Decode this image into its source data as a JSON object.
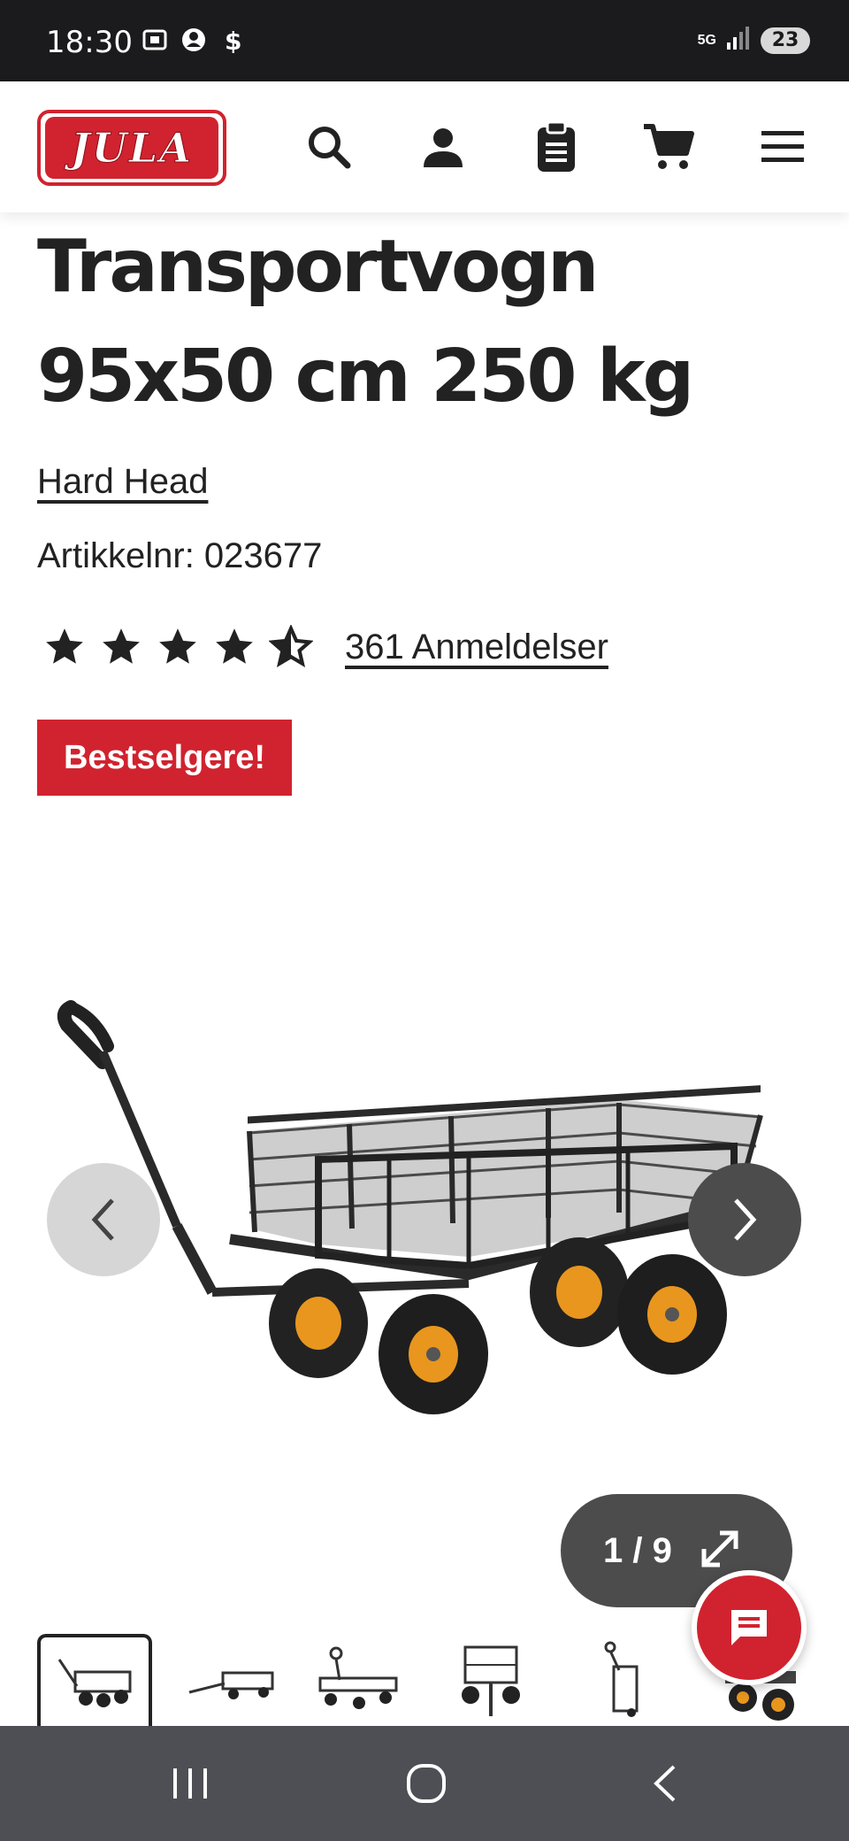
{
  "status_bar": {
    "time": "18:30",
    "network": "5G",
    "battery": "23",
    "icons": [
      "screenshot-icon",
      "account-icon",
      "dollar-icon",
      "signal-icon"
    ]
  },
  "header": {
    "logo_text": "JULA",
    "icons": [
      "search-icon",
      "account-icon",
      "clipboard-icon",
      "cart-icon",
      "menu-icon"
    ]
  },
  "product": {
    "title": "Transportvogn 95x50 cm 250 kg",
    "brand": "Hard Head",
    "article_number": "Artikkelnr: 023677",
    "rating": 4.5,
    "reviews_label": "361 Anmeldelser",
    "badge": "Bestselgere!"
  },
  "gallery": {
    "counter": "1 / 9",
    "current": 1,
    "total": 9,
    "thumbnails": [
      "wagon-front",
      "wagon-side",
      "wagon-flat",
      "wagon-cage-front",
      "wagon-upright",
      "wagon-wheels"
    ]
  },
  "colors": {
    "brand_red": "#d0232f",
    "text": "#222222",
    "dark_button": "#4c4c4c",
    "wheel_hub": "#e8961e"
  }
}
